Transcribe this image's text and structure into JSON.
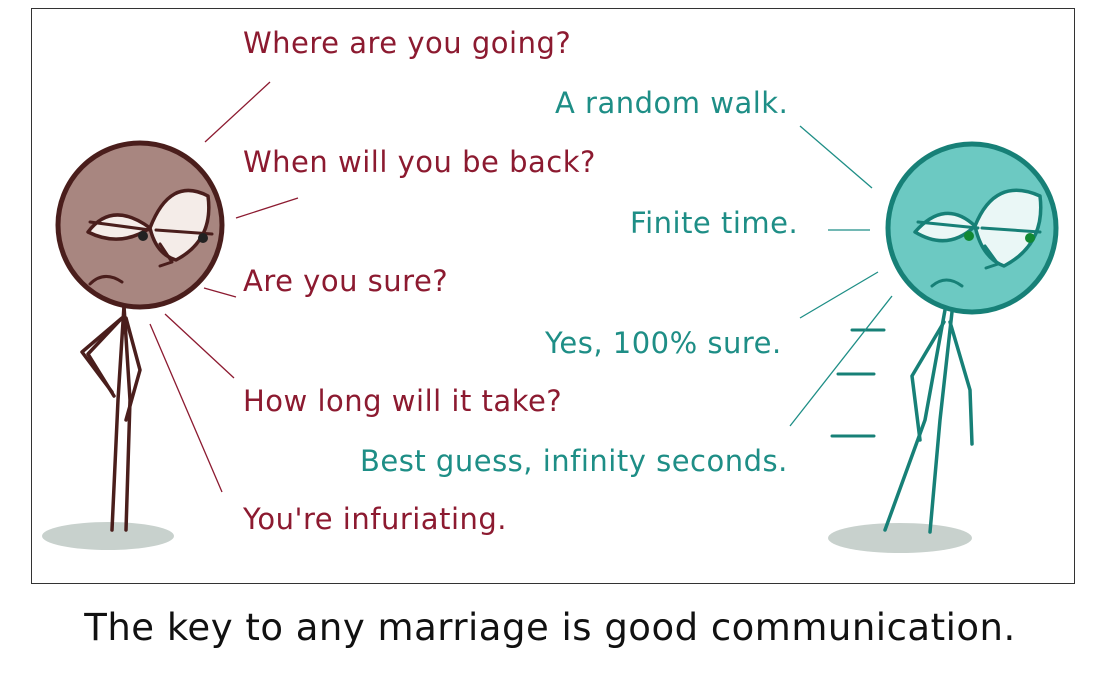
{
  "comic": {
    "left_character_lines": [
      "Where are you going?",
      "When will you be back?",
      "Are you sure?",
      "How long will it take?",
      "You're infuriating."
    ],
    "right_character_lines": [
      "A random walk.",
      "Finite time.",
      "Yes, 100% sure.",
      "Best guess, infinity seconds."
    ],
    "caption": "The key to any marriage is good communication."
  },
  "colors": {
    "left_character": "#8c1a30",
    "left_face": "#a88680",
    "right_character": "#1e8e86",
    "right_face": "#6cc9c2",
    "ground": "#9aaba4",
    "panel_border": "#333333"
  }
}
